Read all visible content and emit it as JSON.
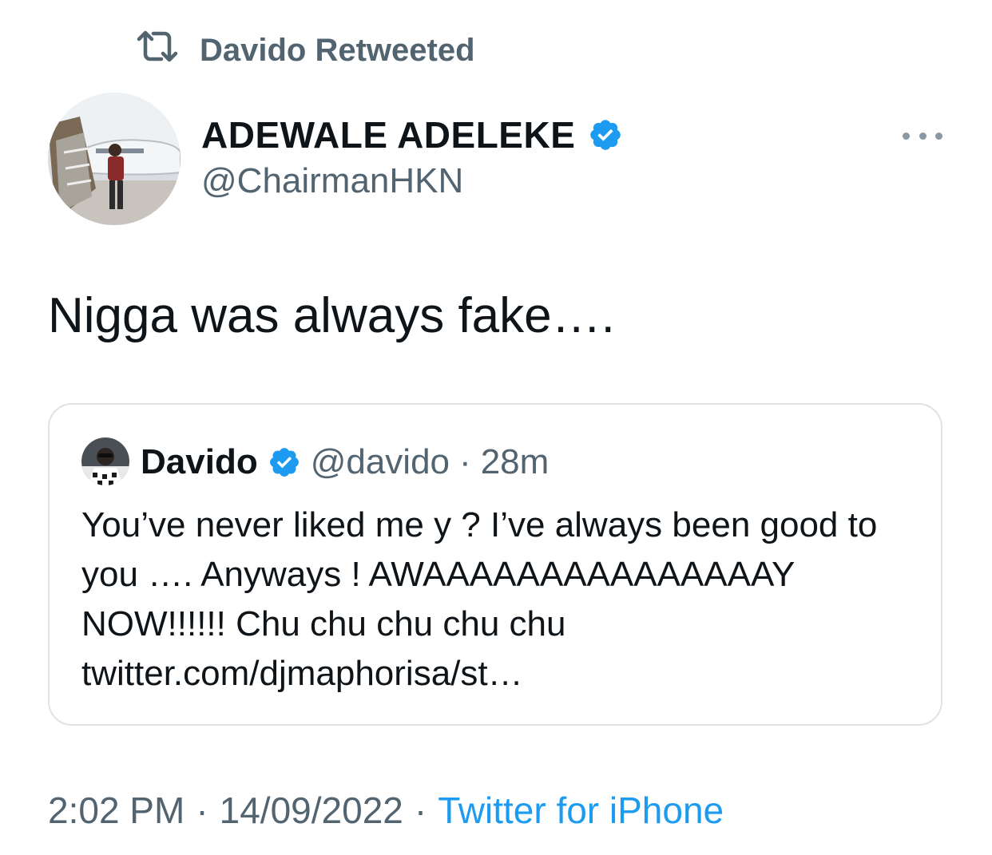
{
  "retweet": {
    "label": "Davido Retweeted"
  },
  "author": {
    "name": "ADEWALE ADELEKE",
    "handle": "@ChairmanHKN",
    "verified": true
  },
  "tweet": {
    "text": "Nigga was always fake…."
  },
  "quoted": {
    "name": "Davido",
    "handle": "@davido",
    "separator": "·",
    "time": "28m",
    "verified": true,
    "text": "You’ve never liked me y ? I’ve always been good to you …. Anyways ! AWAAAAAAAAAAAAAAAY NOW!!!!!! Chu chu chu chu chu twitter.com/djmaphorisa/st…"
  },
  "meta": {
    "time": "2:02 PM",
    "separator": "·",
    "date": "14/09/2022",
    "source": "Twitter for iPhone"
  },
  "icons": {
    "retweet": "retweet-icon",
    "verified": "verified-badge-icon",
    "more": "more-options-icon"
  },
  "colors": {
    "text": "#0f1419",
    "secondary": "#536471",
    "accent": "#1d9bf0",
    "border": "#dfe3e6"
  }
}
